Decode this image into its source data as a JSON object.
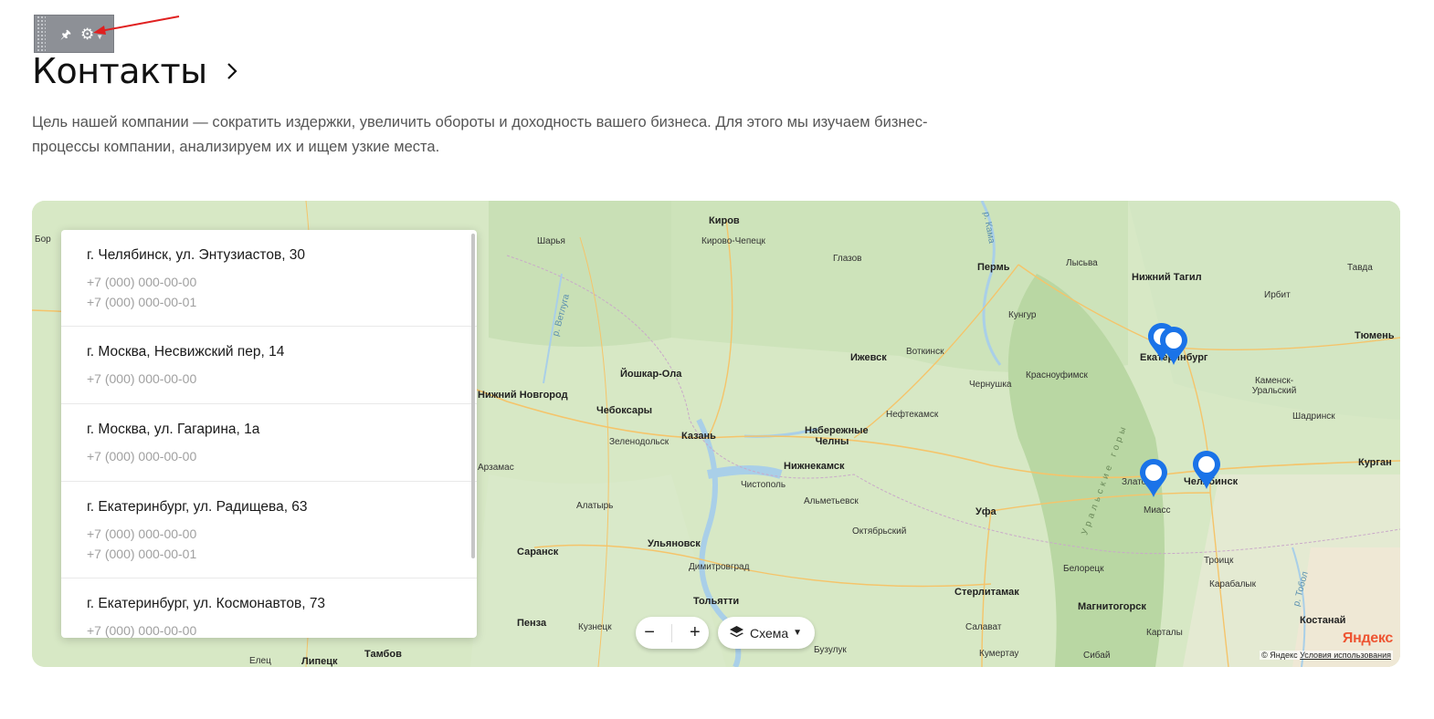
{
  "admin_toolbar": {
    "pin_icon": "pin-icon",
    "settings_icon": "gear-icon"
  },
  "page": {
    "title": "Контакты",
    "intro": "Цель нашей компании — сократить издержки, увеличить обороты и доходность вашего бизнеса. Для этого мы изучаем бизнес-процессы компании, анализируем их и ищем узкие места."
  },
  "contacts": [
    {
      "address": "г. Челябинск, ул. Энтузиастов, 30",
      "phones": [
        "+7 (000) 000-00-00",
        "+7 (000) 000-00-01"
      ]
    },
    {
      "address": "г. Москва, Несвижский пер, 14",
      "phones": [
        "+7 (000) 000-00-00"
      ]
    },
    {
      "address": "г. Москва, ул. Гагарина, 1а",
      "phones": [
        "+7 (000) 000-00-00"
      ]
    },
    {
      "address": "г. Екатеринбург, ул. Радищева, 63",
      "phones": [
        "+7 (000) 000-00-00",
        "+7 (000) 000-00-01"
      ]
    },
    {
      "address": "г. Екатеринбург, ул. Космонавтов, 73",
      "phones": [
        "+7 (000) 000-00-00"
      ]
    }
  ],
  "map": {
    "zoom_out": "−",
    "zoom_in": "+",
    "layer_label": "Схема",
    "logo": "Яндекс",
    "copyright": "© Яндекс",
    "terms": "Условия использования",
    "marker_color": "#1a73e8",
    "labels": [
      "Киров",
      "Кирово-Чепецк",
      "Шарья",
      "Глазов",
      "Пермь",
      "Лысьва",
      "Нижний Тагил",
      "Тавда",
      "Ирбит",
      "Тюмень",
      "Кунгур",
      "Екатеринбург",
      "Ижевск",
      "Воткинск",
      "Чернушка",
      "Красноуфимск",
      "Каменск-Уральский",
      "Йошкар-Ола",
      "Нижний Новгород",
      "Чебоксары",
      "Нефтекамск",
      "Шадринск",
      "Казань",
      "Зеленодольск",
      "Набережные Челны",
      "Нижнекамск",
      "Курган",
      "Златоуст",
      "Челябинск",
      "Чистополь",
      "Альметьевск",
      "Уфа",
      "Миасс",
      "Алатырь",
      "Октябрьский",
      "Саранск",
      "Ульяновск",
      "Димитровград",
      "Троицк",
      "Белорецк",
      "Стерлитамак",
      "Карабалык",
      "Магнитогорск",
      "Тольятти",
      "Пенза",
      "Кузнецк",
      "Салават",
      "Карталы",
      "Костанай",
      "Елец",
      "Липецк",
      "Тамбов",
      "Бузулук",
      "Кумертау",
      "Сибай",
      "Бор",
      "Арзамас",
      "р. Ветлуга",
      "р. Кама",
      "р. Тобол",
      "Уральские горы"
    ]
  }
}
